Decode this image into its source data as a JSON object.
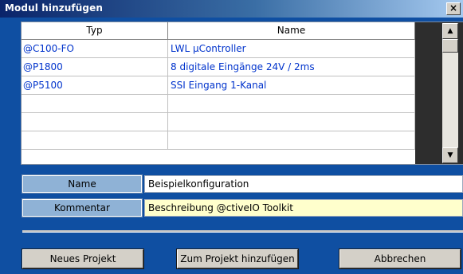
{
  "window": {
    "title": "Modul hinzufügen",
    "close_label": "×"
  },
  "grid": {
    "columns": [
      "Typ",
      "Name"
    ],
    "rows": [
      {
        "typ": "@C100-FO",
        "name": "LWL µController"
      },
      {
        "typ": "@P1800",
        "name": "8 digitale Eingänge 24V / 2ms"
      },
      {
        "typ": "@P5100",
        "name": "SSI Eingang 1-Kanal"
      },
      {
        "typ": "",
        "name": ""
      },
      {
        "typ": "",
        "name": ""
      },
      {
        "typ": "",
        "name": ""
      }
    ],
    "scroll_up": "▲",
    "scroll_down": "▼"
  },
  "form": {
    "name_label": "Name",
    "name_value": "Beispielkonfiguration",
    "comment_label": "Kommentar",
    "comment_value": "Beschreibung @ctiveIO Toolkit"
  },
  "buttons": {
    "new_project": "Neues Projekt",
    "add_to_project": "Zum Projekt hinzufügen",
    "cancel": "Abbrechen"
  },
  "colors": {
    "dialog_bg": "#0f4fa2",
    "title_bg": "#0a246a",
    "cell_text": "#0033cc",
    "label_bg": "#8fb2d6",
    "comment_bg": "#ffffcc"
  }
}
